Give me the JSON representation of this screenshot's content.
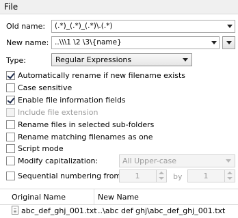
{
  "menu": {
    "file": "File"
  },
  "old_name": {
    "label": "Old name:",
    "value": "(.*)_(.*)_(.*)\\.(.*)"
  },
  "new_name": {
    "label": "New name:",
    "value": "..\\\\\\1 \\2 \\3\\{name}"
  },
  "type": {
    "label": "Type:",
    "value": "Regular Expressions"
  },
  "options": [
    {
      "label": "Automatically rename if new filename exists",
      "checked": true,
      "disabled": false
    },
    {
      "label": "Case sensitive",
      "checked": false,
      "disabled": false
    },
    {
      "label": "Enable file information fields",
      "checked": true,
      "disabled": false
    },
    {
      "label": "Include file extension",
      "checked": false,
      "disabled": true
    },
    {
      "label": "Rename files in selected sub-folders",
      "checked": false,
      "disabled": false
    },
    {
      "label": "Rename matching filenames as one",
      "checked": false,
      "disabled": false
    },
    {
      "label": "Script mode",
      "checked": false,
      "disabled": false
    }
  ],
  "capitalization": {
    "label": "Modify capitalization:",
    "checked": false,
    "value": "All Upper-case"
  },
  "numbering": {
    "label": "Sequential numbering from",
    "checked": false,
    "from": "1",
    "by_label": "by",
    "by": "1"
  },
  "table": {
    "columns": [
      "Original Name",
      "New Name"
    ],
    "rows": [
      {
        "original": "abc_def_ghj_001.txt",
        "new": "..\\abc def ghj\\abc_def_ghj_001.txt"
      }
    ]
  }
}
